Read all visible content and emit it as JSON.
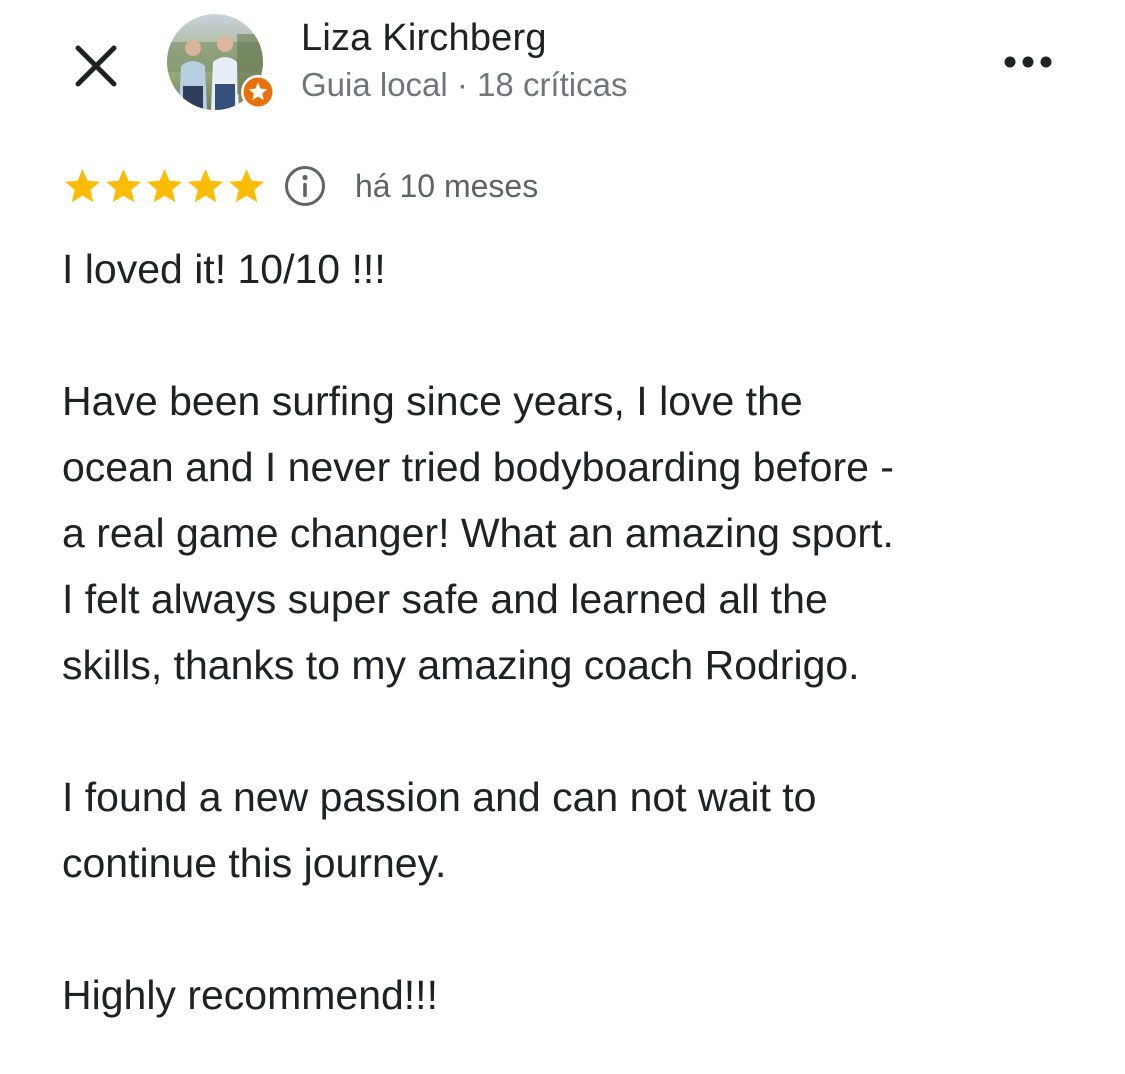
{
  "header": {
    "close_icon": "close-icon",
    "more_icon": "more-horizontal-icon",
    "reviewer": {
      "name": "Liza Kirchberg",
      "subtitle": "Guia local · 18 críticas",
      "badge_icon": "local-guide-star-icon",
      "badge_color": "#e8710a"
    }
  },
  "rating": {
    "stars": 5,
    "max_stars": 5,
    "star_color": "#fbbc04",
    "info_icon": "info-icon",
    "date": "há 10 meses"
  },
  "review": {
    "paragraphs": [
      [
        "I loved it! 10/10 !!!"
      ],
      [
        "Have been surfing since years, I love the",
        "ocean and I never tried bodyboarding before -",
        "a real game changer! What an amazing sport.",
        "I felt always super safe and learned all the",
        "skills, thanks to my amazing coach Rodrigo."
      ],
      [
        "I found a new passion and can not wait to",
        "continue this journey."
      ],
      [
        "Highly recommend!!!"
      ]
    ]
  }
}
